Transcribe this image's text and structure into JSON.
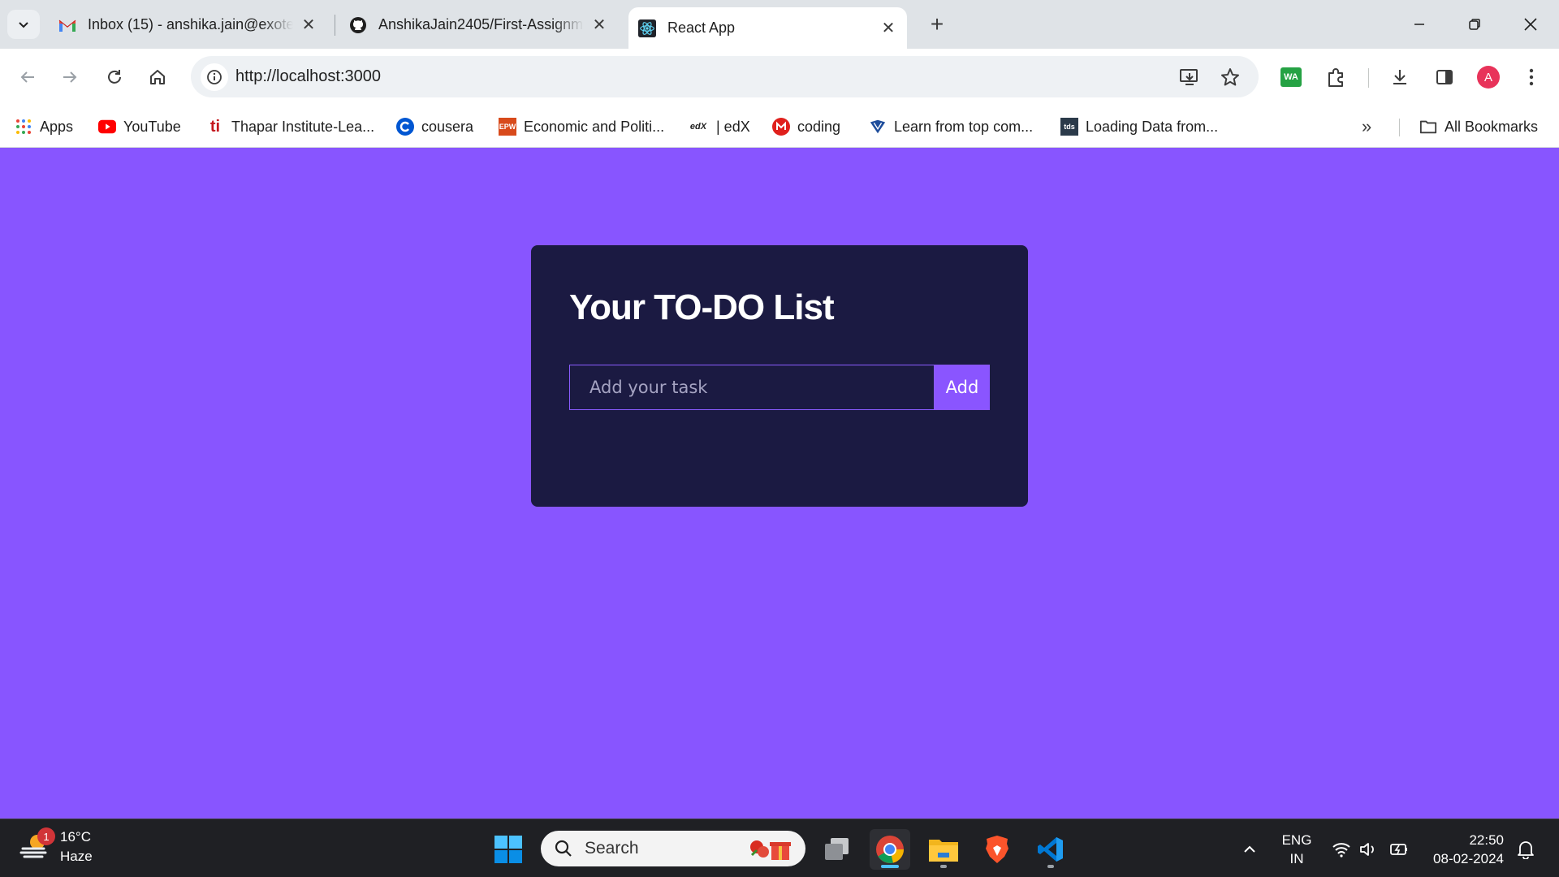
{
  "browser": {
    "tabs": [
      {
        "title": "Inbox (15) - anshika.jain@exotel.in",
        "icon": "gmail-icon"
      },
      {
        "title": "AnshikaJain2405/First-Assignment",
        "icon": "github-icon"
      },
      {
        "title": "React App",
        "icon": "react-icon",
        "active": true
      }
    ],
    "address": "http://localhost:3000",
    "extension_wa": "WA",
    "profile_initial": "A",
    "bookmarks": [
      {
        "label": "Apps",
        "icon": "apps-grid-icon"
      },
      {
        "label": "YouTube",
        "icon": "youtube-icon"
      },
      {
        "label": "Thapar Institute-Lea...",
        "icon": "thapar-icon"
      },
      {
        "label": "cousera",
        "icon": "coursera-icon"
      },
      {
        "label": "Economic and Politi...",
        "icon": "epw-icon"
      },
      {
        "label": "| edX",
        "icon": "edx-icon"
      },
      {
        "label": "coding",
        "icon": "coding-icon"
      },
      {
        "label": "Learn from top com...",
        "icon": "learn-icon"
      },
      {
        "label": "Loading Data from...",
        "icon": "tds-icon"
      }
    ],
    "all_bookmarks": "All Bookmarks"
  },
  "page": {
    "title": "Your TO-DO List",
    "input_placeholder": "Add your task",
    "add_label": "Add"
  },
  "taskbar": {
    "weather_temp": "16°C",
    "weather_desc": "Haze",
    "weather_badge": "1",
    "search_label": "Search",
    "lang_top": "ENG",
    "lang_bottom": "IN",
    "time": "22:50",
    "date": "08-02-2024"
  },
  "colors": {
    "page_bg": "#8855ff",
    "card_bg": "#1b1a42",
    "accent": "#8a55ff"
  }
}
